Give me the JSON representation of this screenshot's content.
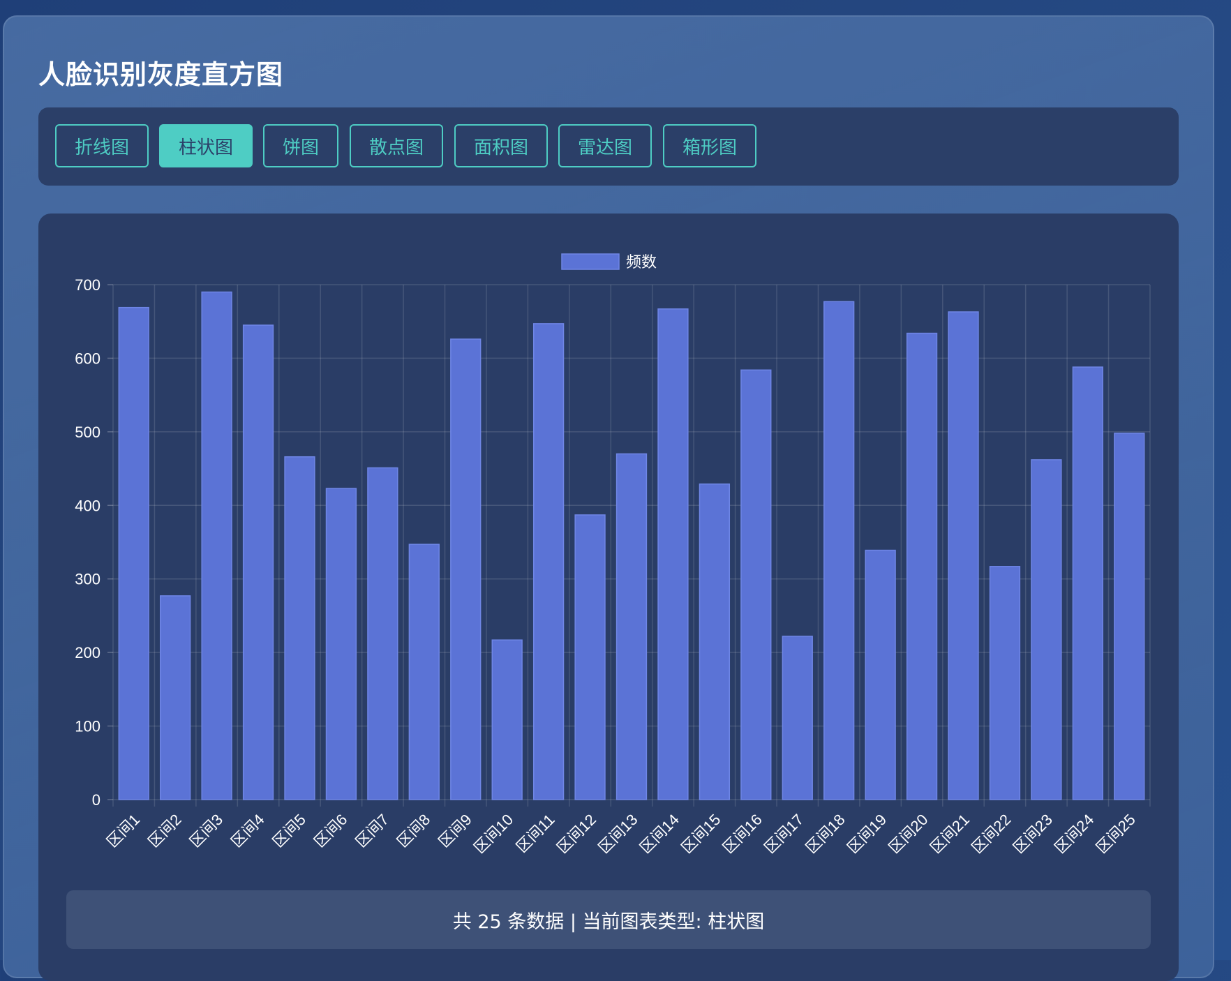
{
  "page": {
    "title": "人脸识别灰度直方图"
  },
  "tabs": [
    {
      "label": "折线图",
      "active": false
    },
    {
      "label": "柱状图",
      "active": true
    },
    {
      "label": "饼图",
      "active": false
    },
    {
      "label": "散点图",
      "active": false
    },
    {
      "label": "面积图",
      "active": false
    },
    {
      "label": "雷达图",
      "active": false
    },
    {
      "label": "箱形图",
      "active": false
    }
  ],
  "footer": {
    "summary": "共 25 条数据 | 当前图表类型: 柱状图"
  },
  "colors": {
    "accent": "#4ecdc4",
    "bar_fill": "#5b73d6",
    "bar_stroke": "#6f86e6"
  },
  "chart_data": {
    "type": "bar",
    "categories": [
      "区间1",
      "区间2",
      "区间3",
      "区间4",
      "区间5",
      "区间6",
      "区间7",
      "区间8",
      "区间9",
      "区间10",
      "区间11",
      "区间12",
      "区间13",
      "区间14",
      "区间15",
      "区间16",
      "区间17",
      "区间18",
      "区间19",
      "区间20",
      "区间21",
      "区间22",
      "区间23",
      "区间24",
      "区间25"
    ],
    "series": [
      {
        "name": "频数",
        "values": [
          669,
          277,
          690,
          645,
          466,
          423,
          451,
          347,
          626,
          217,
          647,
          387,
          470,
          667,
          429,
          584,
          222,
          677,
          339,
          634,
          663,
          317,
          462,
          588,
          498
        ]
      }
    ],
    "ylim": [
      0,
      700
    ],
    "yticks": [
      0,
      100,
      200,
      300,
      400,
      500,
      600,
      700
    ],
    "grid": true,
    "legend_position": "top-center"
  }
}
